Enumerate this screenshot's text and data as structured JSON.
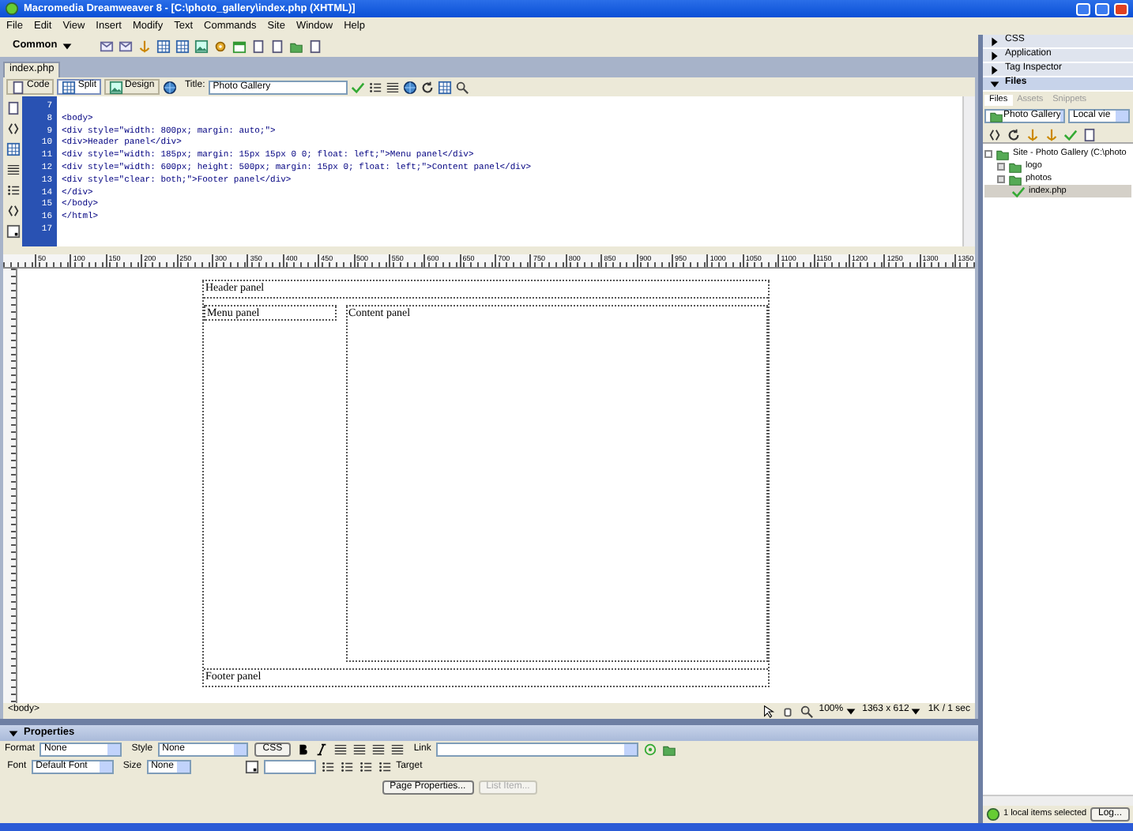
{
  "window": {
    "title": "Macromedia Dreamweaver 8 - [C:\\photo_gallery\\index.php (XHTML)]"
  },
  "menu": [
    "File",
    "Edit",
    "View",
    "Insert",
    "Modify",
    "Text",
    "Commands",
    "Site",
    "Window",
    "Help"
  ],
  "insert_bar": {
    "category": "Common"
  },
  "document": {
    "tab": "index.php",
    "view_buttons": [
      {
        "label": "Code",
        "selected": false
      },
      {
        "label": "Split",
        "selected": true
      },
      {
        "label": "Design",
        "selected": false
      }
    ],
    "title_label": "Title:",
    "title_value": "Photo Gallery",
    "code_lines": [
      {
        "number": "7"
      },
      {
        "number": "8",
        "text": "<body>"
      },
      {
        "number": "9",
        "text": "<div style=\"width: 800px; margin: auto;\">"
      },
      {
        "number": "10",
        "text": "<div>Header panel</div>"
      },
      {
        "number": "11",
        "text": "<div style=\"width: 185px; margin: 15px 15px 0 0; float: left;\">Menu panel</div>"
      },
      {
        "number": "12",
        "text": "<div style=\"width: 600px; height: 500px; margin: 15px 0; float: left;\">Content panel</div>"
      },
      {
        "number": "13",
        "text": "<div style=\"clear: both;\">Footer panel</div>"
      },
      {
        "number": "14",
        "text": "</div>"
      },
      {
        "number": "15",
        "text": "</body>"
      },
      {
        "number": "16",
        "text": "</html>"
      },
      {
        "number": "17"
      }
    ],
    "ruler_labels": [
      "50",
      "100",
      "150",
      "200",
      "250",
      "300",
      "350",
      "400",
      "450",
      "500",
      "550",
      "600",
      "650",
      "700",
      "750",
      "800",
      "850",
      "900",
      "950",
      "1000",
      "1050",
      "1100",
      "1150",
      "1200",
      "1250",
      "1300",
      "1350"
    ],
    "design": {
      "header": "Header panel",
      "menu": "Menu panel",
      "content": "Content panel",
      "footer": "Footer panel"
    },
    "status": {
      "tag": "<body>",
      "zoom": "100%",
      "size": "1363 x 612",
      "weight": "1K / 1 sec"
    }
  },
  "properties": {
    "title": "Properties",
    "expanded": true,
    "format_label": "Format",
    "format_value": "None",
    "style_label": "Style",
    "style_value": "None",
    "css_button": "CSS",
    "link_label": "Link",
    "font_label": "Font",
    "font_value": "Default Font",
    "size_label": "Size",
    "size_value": "None",
    "target_label": "Target",
    "buttons": [
      {
        "label": "Page Properties...",
        "disabled": false
      },
      {
        "label": "List Item...",
        "disabled": true
      }
    ]
  },
  "panels": [
    {
      "label": "CSS",
      "expanded": false
    },
    {
      "label": "Application",
      "expanded": false
    },
    {
      "label": "Tag Inspector",
      "expanded": false
    },
    {
      "label": "Files",
      "expanded": true
    }
  ],
  "files": {
    "tabs": [
      {
        "label": "Files",
        "selected": true
      },
      {
        "label": "Assets",
        "selected": false
      },
      {
        "label": "Snippets",
        "selected": false
      }
    ],
    "site": "Photo Gallery",
    "view": "Local vie",
    "tree": [
      {
        "label": "Site - Photo Gallery (C:\\photo",
        "kind": "site",
        "expanded": true,
        "selected": false,
        "children": [
          {
            "label": "logo",
            "kind": "folder",
            "expanded": false,
            "selected": false
          },
          {
            "label": "photos",
            "kind": "folder",
            "expanded": false,
            "selected": false
          },
          {
            "label": "index.php",
            "kind": "file",
            "selected": true
          }
        ]
      }
    ],
    "status": "1 local items selected",
    "log_button": "Log..."
  }
}
